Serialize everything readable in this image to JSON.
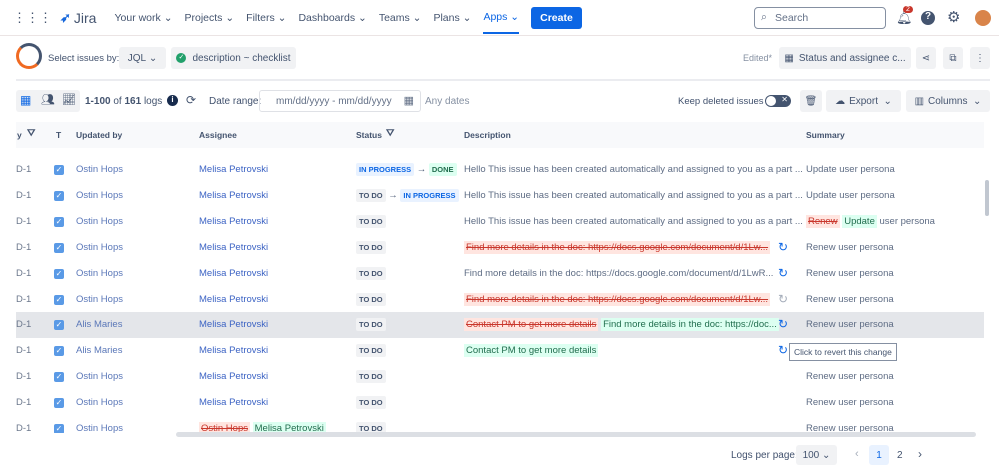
{
  "nav": {
    "app": "Jira",
    "items": [
      "Your work",
      "Projects",
      "Filters",
      "Dashboards",
      "Teams",
      "Plans",
      "Apps"
    ],
    "create": "Create",
    "search_placeholder": "Search",
    "notification_count": "2"
  },
  "toolbar": {
    "select_label": "Select issues by:",
    "jql": "JQL",
    "query": "description ~ checklist",
    "edited": "Edited*",
    "view": "Status and assignee c..."
  },
  "subbar": {
    "range_bold1": "1-100",
    "of": "of",
    "total": "161",
    "logs": "logs",
    "date_label": "Date range:",
    "date_placeholder": "mm/dd/yyyy - mm/dd/yyyy",
    "any_dates": "Any dates",
    "keep_deleted": "Keep deleted issues",
    "export": "Export",
    "columns": "Columns"
  },
  "table": {
    "headers": {
      "key": "y",
      "type": "T",
      "updated_by": "Updated by",
      "assignee": "Assignee",
      "status": "Status",
      "description": "Description",
      "summary": "Summary"
    },
    "rows": [
      {
        "key": "D-1",
        "updated_by": "Ostin Hops",
        "assignee": "Melisa Petrovski",
        "status_from": "IN PROGRESS",
        "status_to": "DONE",
        "description": "Hello This issue has been created automatically and assigned to you as a part ...",
        "summary": "Update user persona"
      },
      {
        "key": "D-1",
        "updated_by": "Ostin Hops",
        "assignee": "Melisa Petrovski",
        "status_from": "TO DO",
        "status_to": "IN PROGRESS",
        "description": "Hello This issue has been created automatically and assigned to you as a part ...",
        "summary": "Update user persona"
      },
      {
        "key": "D-1",
        "updated_by": "Ostin Hops",
        "assignee": "Melisa Petrovski",
        "status_from": "TO DO",
        "description": "Hello This issue has been created automatically and assigned to you as a part ...",
        "summary_old": "Renew",
        "summary_new": "Update",
        "summary_rest": "user persona"
      },
      {
        "key": "D-1",
        "updated_by": "Ostin Hops",
        "assignee": "Melisa Petrovski",
        "status_from": "TO DO",
        "description_old": "Find more details in the doc: https://docs.google.com/document/d/1Lw...",
        "summary": "Renew user persona"
      },
      {
        "key": "D-1",
        "updated_by": "Ostin Hops",
        "assignee": "Melisa Petrovski",
        "status_from": "TO DO",
        "description": "Find more details in the doc: https://docs.google.com/document/d/1LwR...",
        "summary": "Renew user persona"
      },
      {
        "key": "D-1",
        "updated_by": "Ostin Hops",
        "assignee": "Melisa Petrovski",
        "status_from": "TO DO",
        "description_old": "Find more details in the doc: https://docs.google.com/document/d/1Lw...",
        "summary": "Renew user persona"
      },
      {
        "key": "D-1",
        "updated_by": "Alis Maries",
        "assignee": "Melisa Petrovski",
        "status_from": "TO DO",
        "description_old": "Contact PM to get more details",
        "description_new": "Find more details in the doc: https://doc...",
        "summary": "Renew user persona"
      },
      {
        "key": "D-1",
        "updated_by": "Alis Maries",
        "assignee": "Melisa Petrovski",
        "status_from": "TO DO",
        "description_new": "Contact PM to get more details"
      },
      {
        "key": "D-1",
        "updated_by": "Ostin Hops",
        "assignee": "Melisa Petrovski",
        "status_from": "TO DO",
        "summary": "Renew user persona"
      },
      {
        "key": "D-1",
        "updated_by": "Ostin Hops",
        "assignee": "Melisa Petrovski",
        "status_from": "TO DO",
        "summary": "Renew user persona"
      },
      {
        "key": "D-1",
        "updated_by": "Ostin Hops",
        "assignee_old": "Ostin Hops",
        "assignee_new": "Melisa Petrovski",
        "status_from": "TO DO",
        "summary": "Renew user persona"
      }
    ]
  },
  "tooltip": "Click to revert this change",
  "pagination": {
    "label": "Logs per page:",
    "per_page": "100",
    "pages": [
      "1",
      "2"
    ],
    "current": "1"
  },
  "colors": {
    "accent": "#0c66e4"
  }
}
